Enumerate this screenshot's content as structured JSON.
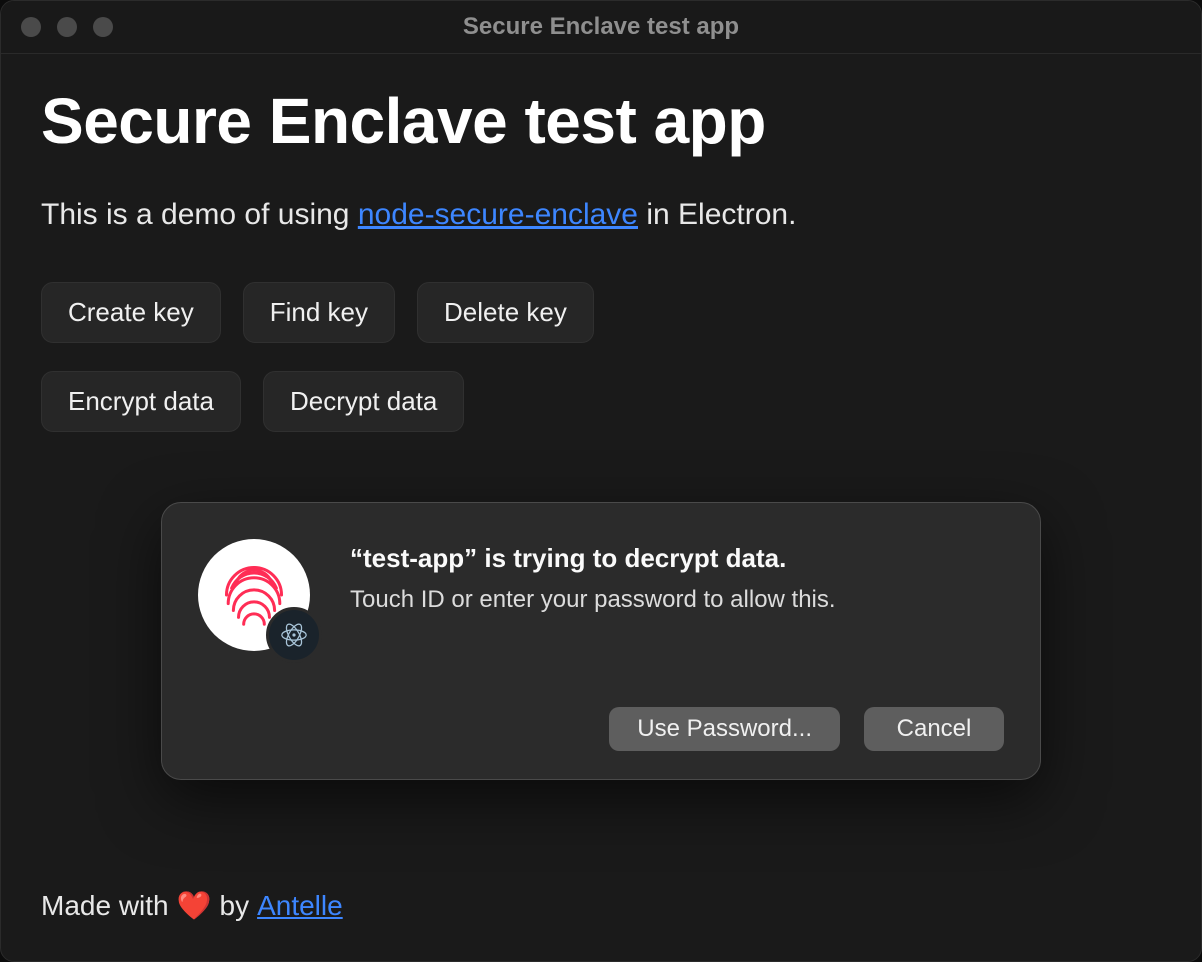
{
  "window": {
    "title": "Secure Enclave test app"
  },
  "header": {
    "title": "Secure Enclave test app",
    "intro_prefix": "This is a demo of using ",
    "intro_link": "node-secure-enclave",
    "intro_suffix": " in Electron."
  },
  "actions": {
    "row1": [
      {
        "id": "create-key",
        "label": "Create key"
      },
      {
        "id": "find-key",
        "label": "Find key"
      },
      {
        "id": "delete-key",
        "label": "Delete key"
      }
    ],
    "row2": [
      {
        "id": "encrypt-data",
        "label": "Encrypt data"
      },
      {
        "id": "decrypt-data",
        "label": "Decrypt data"
      }
    ]
  },
  "dialog": {
    "title": "“test-app” is trying to decrypt data.",
    "subtitle": "Touch ID or enter your password to allow this.",
    "use_password": "Use Password...",
    "cancel": "Cancel"
  },
  "footer": {
    "prefix": "Made with ",
    "heart": "❤️",
    "middle": " by ",
    "author": "Antelle"
  },
  "colors": {
    "link": "#3d86ff",
    "fingerprint": "#ff2d55"
  }
}
